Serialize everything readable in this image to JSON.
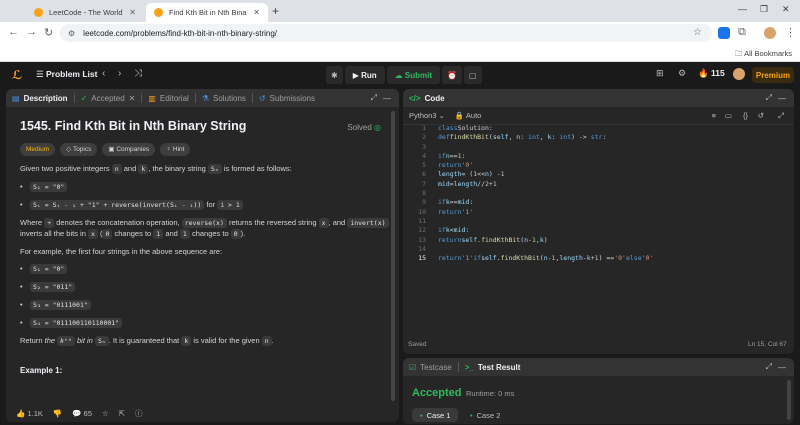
{
  "browser": {
    "tabs": [
      {
        "title": "LeetCode - The World's Leading",
        "active": false
      },
      {
        "title": "Find Kth Bit in Nth Binary String",
        "active": true
      }
    ],
    "new_tab": "+",
    "url": "leetcode.com/problems/find-kth-bit-in-nth-binary-string/",
    "all_bookmarks": "All Bookmarks"
  },
  "nav": {
    "problem_list": "Problem List",
    "run": "Run",
    "submit": "Submit",
    "streak": "115",
    "premium": "Premium"
  },
  "left_tabs": [
    "Description",
    "Accepted",
    "Editorial",
    "Solutions",
    "Submissions"
  ],
  "problem": {
    "title": "1545. Find Kth Bit in Nth Binary String",
    "status": "Solved",
    "difficulty": "Medium",
    "topics": "Topics",
    "companies": "Companies",
    "hint": "Hint",
    "intro_a": "Given two positive integers",
    "var_n": "n",
    "intro_b": "and",
    "var_k": "k",
    "intro_c": ", the binary string",
    "var_sn": "Sₙ",
    "intro_d": "is formed as follows:",
    "rule1": "S₁ = \"0\"",
    "rule2": "Sᵢ = Sᵢ ₋ ₁ + \"1\" + reverse(invert(Sᵢ ₋ ₁))",
    "rule2_for": "for",
    "rule2_cond": "i > 1",
    "where_a": "Where",
    "plus": "+",
    "where_b": "denotes the concatenation operation,",
    "rev": "reverse(x)",
    "where_c": "returns the reversed string",
    "x": "x",
    "where_d": ", and",
    "inv": "invert(x)",
    "where_e": "inverts all the bits in",
    "where_f": "(",
    "zero": "0",
    "where_g": "changes to",
    "one": "1",
    "where_h": "and",
    "where_i": "changes to",
    "where_j": ").",
    "example_intro": "For example, the first four strings in the above sequence are:",
    "seq": [
      "S₁ = \"0\"",
      "S₂ = \"011\"",
      "S₃ = \"0111001\"",
      "S₄ = \"011100110110001\""
    ],
    "return_a": "Return",
    "return_b": "the",
    "return_kth": "kᵗʰ",
    "return_c": "bit",
    "return_d": "in",
    "return_sn": "Sₙ",
    "return_e": ". It is guaranteed that",
    "return_f": "is valid for the given",
    "return_g": ".",
    "example1": "Example 1:",
    "likes": "1.1K",
    "comments": "65"
  },
  "code_panel": {
    "title": "Code",
    "language": "Python3",
    "auto": "Auto",
    "lines": [
      "1",
      "2",
      "3",
      "4",
      "5",
      "6",
      "7",
      "8",
      "9",
      "10",
      "11",
      "12",
      "13",
      "14",
      "15"
    ],
    "saved": "Saved",
    "position": "Ln 15, Col 67"
  },
  "bottom": {
    "testcase": "Testcase",
    "test_result": "Test Result",
    "accepted": "Accepted",
    "runtime": "Runtime: 0 ms",
    "case1": "Case 1",
    "case2": "Case 2"
  }
}
